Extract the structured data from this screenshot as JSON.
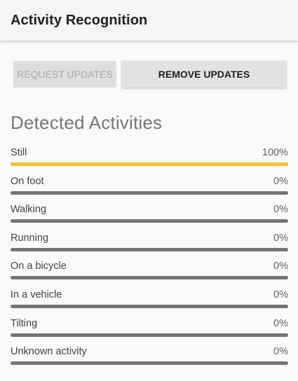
{
  "appbar": {
    "title": "Activity Recognition"
  },
  "buttons": {
    "request_label": "REQUEST UPDATES",
    "remove_label": "REMOVE UPDATES"
  },
  "section": {
    "title": "Detected Activities"
  },
  "colors": {
    "progress_fill": "#f6c031",
    "progress_track": "#757575"
  },
  "activities": [
    {
      "name": "Still",
      "percent": "100%",
      "value": 100
    },
    {
      "name": "On foot",
      "percent": "0%",
      "value": 0
    },
    {
      "name": "Walking",
      "percent": "0%",
      "value": 0
    },
    {
      "name": "Running",
      "percent": "0%",
      "value": 0
    },
    {
      "name": "On a bicycle",
      "percent": "0%",
      "value": 0
    },
    {
      "name": "In a vehicle",
      "percent": "0%",
      "value": 0
    },
    {
      "name": "Tilting",
      "percent": "0%",
      "value": 0
    },
    {
      "name": "Unknown activity",
      "percent": "0%",
      "value": 0
    }
  ]
}
